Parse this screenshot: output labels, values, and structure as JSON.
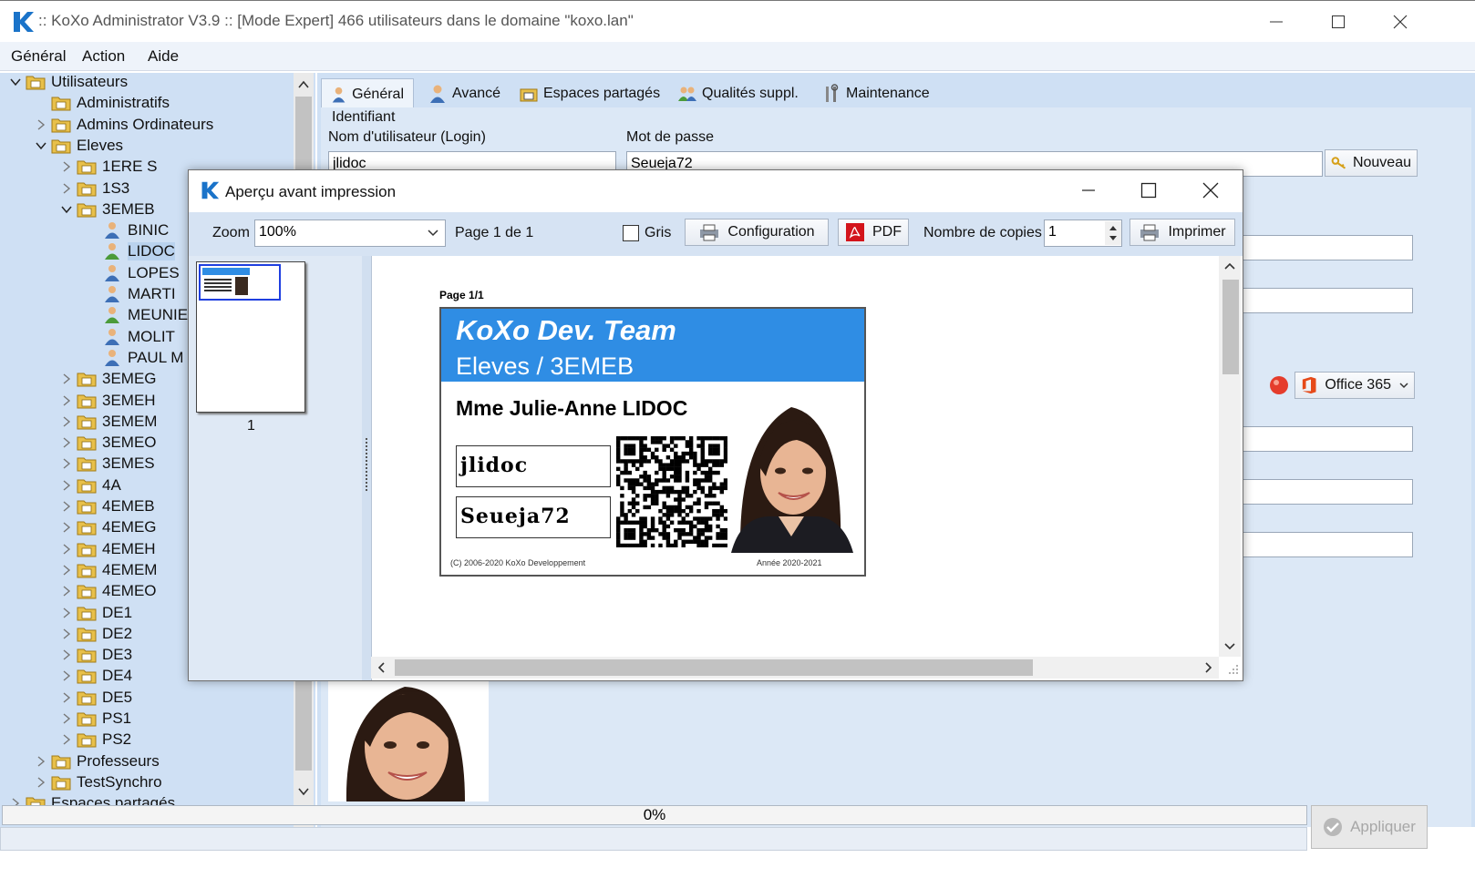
{
  "window": {
    "title": ":: KoXo Administrator V3.9 :: [Mode Expert] 466 utilisateurs dans le domaine \"koxo.lan\""
  },
  "menu": [
    "Général",
    "Action",
    "Aide"
  ],
  "tree": {
    "items": [
      {
        "label": "Utilisateurs",
        "depth": 0,
        "exp": "open",
        "icon": "folder"
      },
      {
        "label": "Administratifs",
        "depth": 1,
        "exp": "none",
        "icon": "folder"
      },
      {
        "label": "Admins Ordinateurs",
        "depth": 1,
        "exp": "closed",
        "icon": "folder"
      },
      {
        "label": "Eleves",
        "depth": 1,
        "exp": "open",
        "icon": "folder"
      },
      {
        "label": "1ERE S",
        "depth": 2,
        "exp": "closed",
        "icon": "folder"
      },
      {
        "label": "1S3",
        "depth": 2,
        "exp": "closed",
        "icon": "folder"
      },
      {
        "label": "3EMEB",
        "depth": 2,
        "exp": "open",
        "icon": "folder"
      },
      {
        "label": "BINIC",
        "depth": 3,
        "exp": "none",
        "icon": "user"
      },
      {
        "label": "LIDOC",
        "depth": 3,
        "exp": "none",
        "icon": "user-green",
        "selected": true
      },
      {
        "label": "LOPES",
        "depth": 3,
        "exp": "none",
        "icon": "user"
      },
      {
        "label": "MARTI",
        "depth": 3,
        "exp": "none",
        "icon": "user"
      },
      {
        "label": "MEUNIE",
        "depth": 3,
        "exp": "none",
        "icon": "user-green"
      },
      {
        "label": "MOLIT",
        "depth": 3,
        "exp": "none",
        "icon": "user"
      },
      {
        "label": "PAUL M",
        "depth": 3,
        "exp": "none",
        "icon": "user"
      },
      {
        "label": "3EMEG",
        "depth": 2,
        "exp": "closed",
        "icon": "folder"
      },
      {
        "label": "3EMEH",
        "depth": 2,
        "exp": "closed",
        "icon": "folder"
      },
      {
        "label": "3EMEM",
        "depth": 2,
        "exp": "closed",
        "icon": "folder"
      },
      {
        "label": "3EMEO",
        "depth": 2,
        "exp": "closed",
        "icon": "folder"
      },
      {
        "label": "3EMES",
        "depth": 2,
        "exp": "closed",
        "icon": "folder"
      },
      {
        "label": "4A",
        "depth": 2,
        "exp": "closed",
        "icon": "folder"
      },
      {
        "label": "4EMEB",
        "depth": 2,
        "exp": "closed",
        "icon": "folder"
      },
      {
        "label": "4EMEG",
        "depth": 2,
        "exp": "closed",
        "icon": "folder"
      },
      {
        "label": "4EMEH",
        "depth": 2,
        "exp": "closed",
        "icon": "folder"
      },
      {
        "label": "4EMEM",
        "depth": 2,
        "exp": "closed",
        "icon": "folder"
      },
      {
        "label": "4EMEO",
        "depth": 2,
        "exp": "closed",
        "icon": "folder"
      },
      {
        "label": "DE1",
        "depth": 2,
        "exp": "closed",
        "icon": "folder"
      },
      {
        "label": "DE2",
        "depth": 2,
        "exp": "closed",
        "icon": "folder"
      },
      {
        "label": "DE3",
        "depth": 2,
        "exp": "closed",
        "icon": "folder"
      },
      {
        "label": "DE4",
        "depth": 2,
        "exp": "closed",
        "icon": "folder"
      },
      {
        "label": "DE5",
        "depth": 2,
        "exp": "closed",
        "icon": "folder"
      },
      {
        "label": "PS1",
        "depth": 2,
        "exp": "closed",
        "icon": "folder"
      },
      {
        "label": "PS2",
        "depth": 2,
        "exp": "closed",
        "icon": "folder"
      },
      {
        "label": "Professeurs",
        "depth": 1,
        "exp": "closed",
        "icon": "folder"
      },
      {
        "label": "TestSynchro",
        "depth": 1,
        "exp": "closed",
        "icon": "folder"
      },
      {
        "label": "Espaces partagés",
        "depth": 0,
        "exp": "closed",
        "icon": "folder"
      }
    ]
  },
  "tabs": {
    "general": "Général",
    "advanced": "Avancé",
    "shared": "Espaces partagés",
    "qualities": "Qualités suppl.",
    "maintenance": "Maintenance"
  },
  "form": {
    "group_label": "Identifiant",
    "login_label": "Nom d'utilisateur (Login)",
    "login_value": "jlidoc",
    "password_label": "Mot de passe",
    "password_value": "Seueja72",
    "new_button": "Nouveau",
    "office_button": "Office 365"
  },
  "status": {
    "progress": "0%",
    "apply": "Appliquer"
  },
  "dialog": {
    "title": "Aperçu avant impression",
    "zoom_label": "Zoom",
    "zoom_value": "100%",
    "page_info": "Page 1 de 1",
    "gray_label": "Gris",
    "config_button": "Configuration",
    "pdf_button": "PDF",
    "copies_label": "Nombre de copies",
    "copies_value": "1",
    "print_button": "Imprimer",
    "thumb_number": "1",
    "page_header": "Page 1/1"
  },
  "card": {
    "team": "KoXo Dev. Team",
    "class": "Eleves / 3EMEB",
    "name": "Mme Julie-Anne LIDOC",
    "login": "jlidoc",
    "password": "Seueja72",
    "copyright": "(C) 2006-2020 KoXo Developpement",
    "year": "Année 2020-2021"
  },
  "colors": {
    "accent": "#2f8de4",
    "panel": "#cfe0f4",
    "logo": "#1a73c9"
  }
}
